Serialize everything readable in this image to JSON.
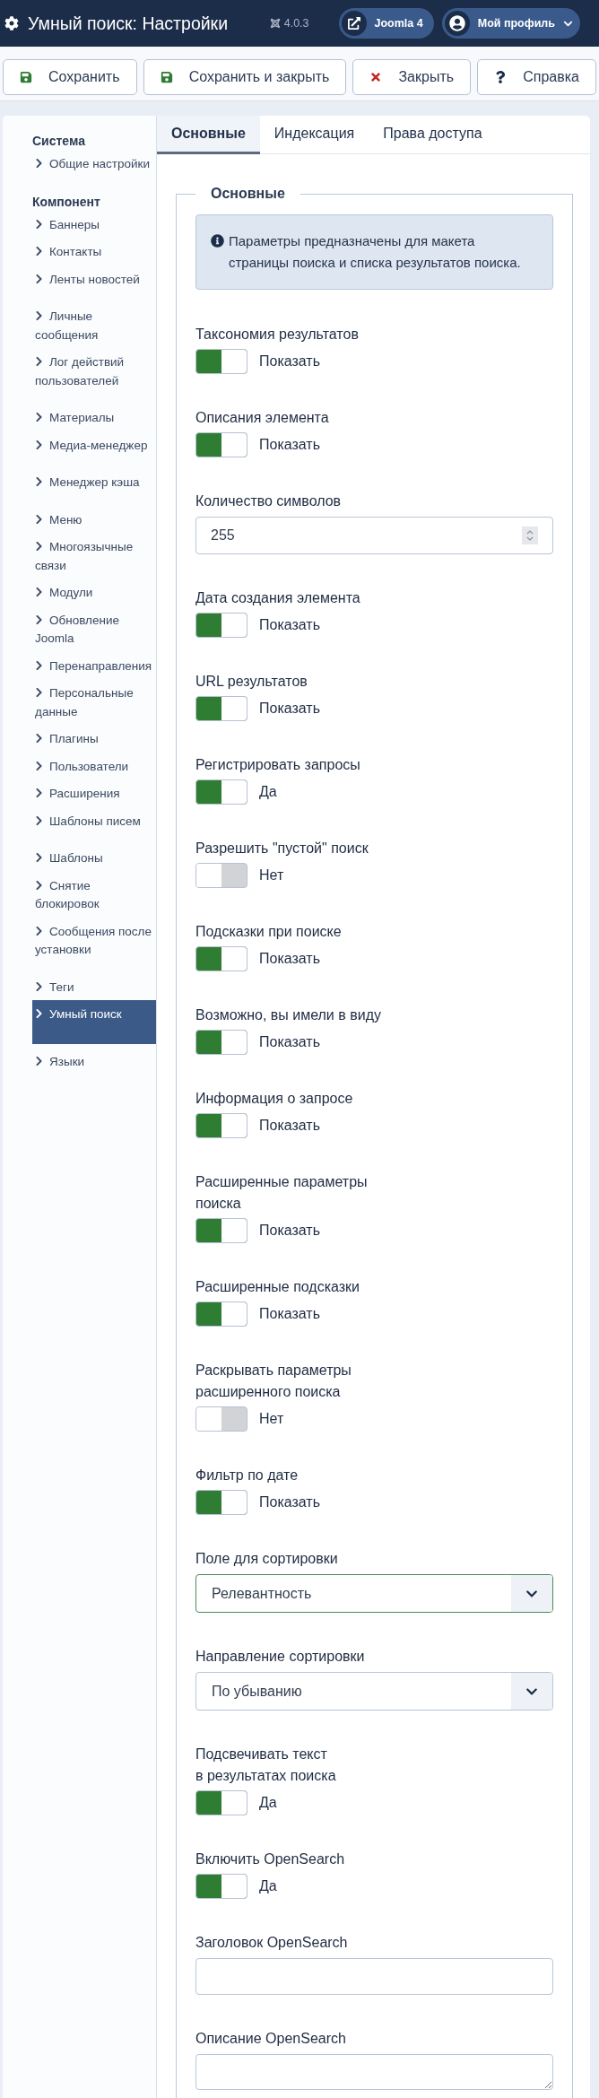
{
  "header": {
    "title": "Умный поиск: Настройки",
    "version": "4.0.3",
    "site_link": "Joomla 4",
    "profile_menu": "Мой профиль"
  },
  "toolbar": [
    {
      "kind": "save",
      "label": "Сохранить"
    },
    {
      "kind": "save_close",
      "label": "Сохранить и закрыть"
    },
    {
      "kind": "close",
      "label": "Закрыть"
    },
    {
      "kind": "help",
      "label": "Справка"
    }
  ],
  "sidebar": [
    {
      "heading": "Система",
      "items": [
        {
          "label": "Общие настройки",
          "selected": false
        }
      ]
    },
    {
      "heading": "Компонент",
      "items": [
        {
          "label": "Баннеры",
          "selected": false
        },
        {
          "label": "Контакты",
          "selected": false
        },
        {
          "label": "Ленты новостей",
          "selected": false
        }
      ]
    },
    {
      "items": [
        {
          "label": "Личные сообщения",
          "selected": false
        },
        {
          "label": "Лог действий пользователей",
          "selected": false
        }
      ]
    },
    {
      "items": [
        {
          "label": "Материалы",
          "selected": false
        },
        {
          "label": "Медиа-менеджер",
          "selected": false
        }
      ]
    },
    {
      "items": [
        {
          "label": "Менеджер кэша",
          "selected": false
        }
      ]
    },
    {
      "items": [
        {
          "label": "Меню",
          "selected": false
        },
        {
          "label": "Многоязычные связи",
          "selected": false
        },
        {
          "label": "Модули",
          "selected": false
        },
        {
          "label": "Обновление Joomla",
          "selected": false
        },
        {
          "label": "Перенаправления",
          "selected": false
        },
        {
          "label": "Персональные данные",
          "selected": false
        },
        {
          "label": "Плагины",
          "selected": false
        },
        {
          "label": "Пользователи",
          "selected": false
        },
        {
          "label": "Расширения",
          "selected": false
        },
        {
          "label": "Шаблоны писем",
          "selected": false
        }
      ]
    },
    {
      "items": [
        {
          "label": "Шаблоны",
          "selected": false
        },
        {
          "label": "Снятие блокировок",
          "selected": false
        },
        {
          "label": "Сообщения после установки",
          "selected": false
        }
      ]
    },
    {
      "items": [
        {
          "label": "Теги",
          "selected": false
        },
        {
          "label": "Умный поиск",
          "selected": true
        },
        {
          "label": "Языки",
          "selected": false
        }
      ]
    }
  ],
  "tabs": [
    {
      "label": "Основные",
      "selected": true
    },
    {
      "label": "Индексация",
      "selected": false
    },
    {
      "label": "Права доступа",
      "selected": false
    }
  ],
  "fieldset": {
    "legend": "Основные",
    "info": "Параметры предназначены для макета страницы поиска и списка результатов поиска.",
    "fields": [
      {
        "kind": "toggle",
        "label": "Таксономия результатов",
        "on": true,
        "value": "Показать"
      },
      {
        "kind": "toggle",
        "label": "Описания элемента",
        "on": true,
        "value": "Показать"
      },
      {
        "kind": "number",
        "label": "Количество символов",
        "value": "255"
      },
      {
        "kind": "toggle",
        "label": "Дата создания элемента",
        "on": true,
        "value": "Показать"
      },
      {
        "kind": "toggle",
        "label": "URL результатов",
        "on": true,
        "value": "Показать"
      },
      {
        "kind": "toggle",
        "label": "Регистрировать запросы",
        "on": true,
        "value": "Да"
      },
      {
        "kind": "toggle",
        "label": "Разрешить \"пустой\" поиск",
        "on": false,
        "value": "Нет"
      },
      {
        "kind": "toggle",
        "label": "Подсказки при поиске",
        "on": true,
        "value": "Показать"
      },
      {
        "kind": "toggle",
        "label": "Возможно, вы имели в виду",
        "on": true,
        "value": "Показать"
      },
      {
        "kind": "toggle",
        "label": "Информация о запросе",
        "on": true,
        "value": "Показать"
      },
      {
        "kind": "toggle",
        "label": "Расширенные параметры\nпоиска",
        "on": true,
        "value": "Показать"
      },
      {
        "kind": "toggle",
        "label": "Расширенные подсказки",
        "on": true,
        "value": "Показать"
      },
      {
        "kind": "toggle",
        "label": "Раскрывать параметры\nрасширенного поиска",
        "on": false,
        "value": "Нет"
      },
      {
        "kind": "toggle",
        "label": "Фильтр по дате",
        "on": true,
        "value": "Показать"
      },
      {
        "kind": "select",
        "label": "Поле для сортировки",
        "value": "Релевантность",
        "valid": true
      },
      {
        "kind": "select",
        "label": "Направление сортировки",
        "value": "По убыванию",
        "valid": false
      },
      {
        "kind": "toggle",
        "label": "Подсвечивать текст\nв результатах поиска",
        "on": true,
        "value": "Да"
      },
      {
        "kind": "toggle",
        "label": "Включить OpenSearch",
        "on": true,
        "value": "Да"
      },
      {
        "kind": "text",
        "label": "Заголовок OpenSearch"
      },
      {
        "kind": "textarea",
        "label": "Описание OpenSearch"
      }
    ]
  }
}
